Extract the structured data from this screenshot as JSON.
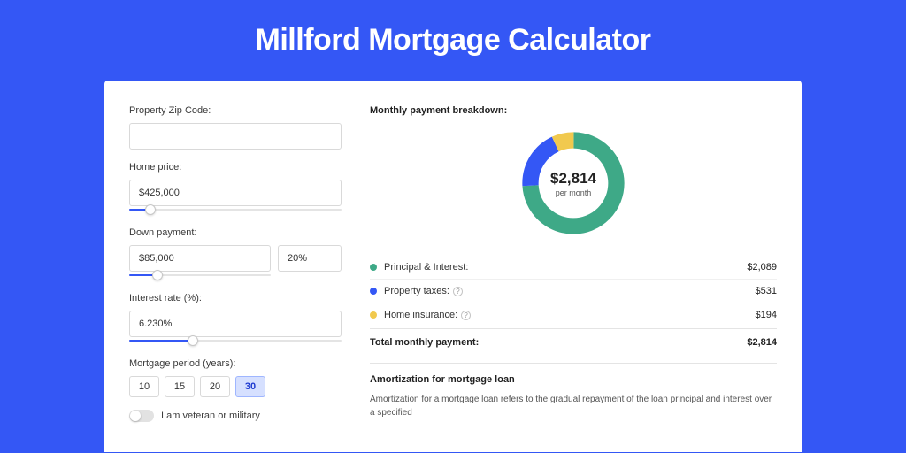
{
  "title": "Millford Mortgage Calculator",
  "colors": {
    "principal": "#3ea987",
    "taxes": "#3457f5",
    "insurance": "#f1c94e"
  },
  "form": {
    "zip_label": "Property Zip Code:",
    "zip_value": "",
    "home_price_label": "Home price:",
    "home_price_value": "$425,000",
    "home_price_slider_pct": 10,
    "down_payment_label": "Down payment:",
    "down_payment_value": "$85,000",
    "down_payment_pct_value": "20%",
    "down_payment_slider_pct": 20,
    "interest_label": "Interest rate (%):",
    "interest_value": "6.230%",
    "interest_slider_pct": 30,
    "period_label": "Mortgage period (years):",
    "period_options": [
      "10",
      "15",
      "20",
      "30"
    ],
    "period_selected": "30",
    "veteran_label": "I am veteran or military",
    "veteran_on": false
  },
  "breakdown": {
    "title": "Monthly payment breakdown:",
    "center_amount": "$2,814",
    "center_sub": "per month",
    "items": [
      {
        "key": "principal",
        "label": "Principal & Interest:",
        "value": "$2,089",
        "pct": 74,
        "info": false
      },
      {
        "key": "taxes",
        "label": "Property taxes:",
        "value": "$531",
        "pct": 19,
        "info": true
      },
      {
        "key": "insurance",
        "label": "Home insurance:",
        "value": "$194",
        "pct": 7,
        "info": true
      }
    ],
    "total_label": "Total monthly payment:",
    "total_value": "$2,814"
  },
  "amortization": {
    "title": "Amortization for mortgage loan",
    "body": "Amortization for a mortgage loan refers to the gradual repayment of the loan principal and interest over a specified"
  },
  "chart_data": {
    "type": "pie",
    "title": "Monthly payment breakdown",
    "series": [
      {
        "name": "Principal & Interest",
        "value": 2089
      },
      {
        "name": "Property taxes",
        "value": 531
      },
      {
        "name": "Home insurance",
        "value": 194
      }
    ],
    "total": 2814,
    "unit": "USD per month"
  }
}
